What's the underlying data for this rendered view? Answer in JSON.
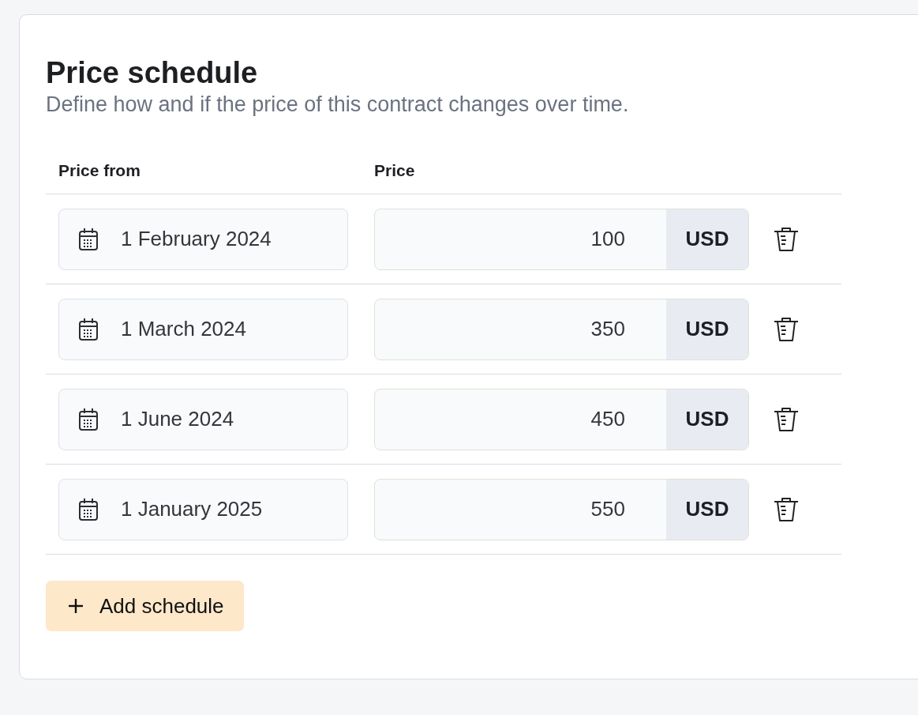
{
  "title": "Price schedule",
  "subtitle": "Define how and if the price of this contract changes over time.",
  "columns": [
    "Price from",
    "Price"
  ],
  "rows": [
    {
      "date": "1 February 2024",
      "price": "100",
      "currency": "USD"
    },
    {
      "date": "1 March 2024",
      "price": "350",
      "currency": "USD"
    },
    {
      "date": "1 June 2024",
      "price": "450",
      "currency": "USD"
    },
    {
      "date": "1 January 2025",
      "price": "550",
      "currency": "USD"
    }
  ],
  "add_button": "Add schedule"
}
